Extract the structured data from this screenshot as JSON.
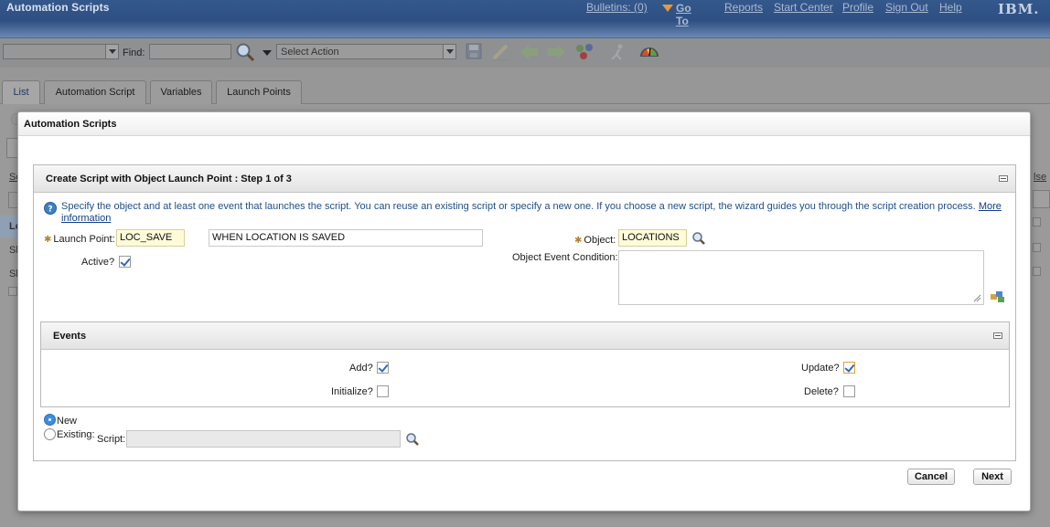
{
  "app": {
    "title": "Automation Scripts",
    "logo": "IBM."
  },
  "header_links": {
    "bulletins": "Bulletins: (0)",
    "goto": "Go To",
    "reports": "Reports",
    "start_center": "Start Center",
    "profile": "Profile",
    "sign_out": "Sign Out",
    "help": "Help"
  },
  "toolbar": {
    "find_label": "Find:",
    "action_select": "Select Action",
    "icons": [
      "search-icon",
      "save-icon",
      "edit-icon",
      "previous-icon",
      "next-icon",
      "workflow-icon",
      "run-icon",
      "gauge-icon"
    ]
  },
  "tabs": [
    {
      "label": "List",
      "active": true
    },
    {
      "label": "Automation Script",
      "active": false
    },
    {
      "label": "Variables",
      "active": false
    },
    {
      "label": "Launch Points",
      "active": false
    }
  ],
  "dialog": {
    "title": "Automation Scripts",
    "section_title": "Create Script with Object Launch Point : Step 1 of 3",
    "info_text": "Specify the object and at least one event that launches the script. You can reuse an existing script or specify a new one. If you choose a new script, the wizard guides you through the script creation process.",
    "info_link": "More information",
    "launch_point_label": "Launch Point:",
    "launch_point_value": "LOC_SAVE",
    "launch_point_description": "WHEN LOCATION IS SAVED",
    "active_label": "Active?",
    "active_checked": true,
    "object_label": "Object:",
    "object_value": "LOCATIONS",
    "object_event_condition_label": "Object Event Condition:",
    "object_event_condition_value": "",
    "events": {
      "title": "Events",
      "add_label": "Add?",
      "add_checked": true,
      "initialize_label": "Initialize?",
      "initialize_checked": false,
      "update_label": "Update?",
      "update_checked": true,
      "delete_label": "Delete?",
      "delete_checked": false
    },
    "script_choice": {
      "new_label": "New",
      "existing_label": "Existing:",
      "selected": "New",
      "script_label": "Script:",
      "script_value": ""
    },
    "cancel_label": "Cancel",
    "next_label": "Next"
  },
  "background": {
    "fragments": [
      "Se",
      "Lo",
      "Sl",
      "Sl",
      "lse"
    ]
  }
}
